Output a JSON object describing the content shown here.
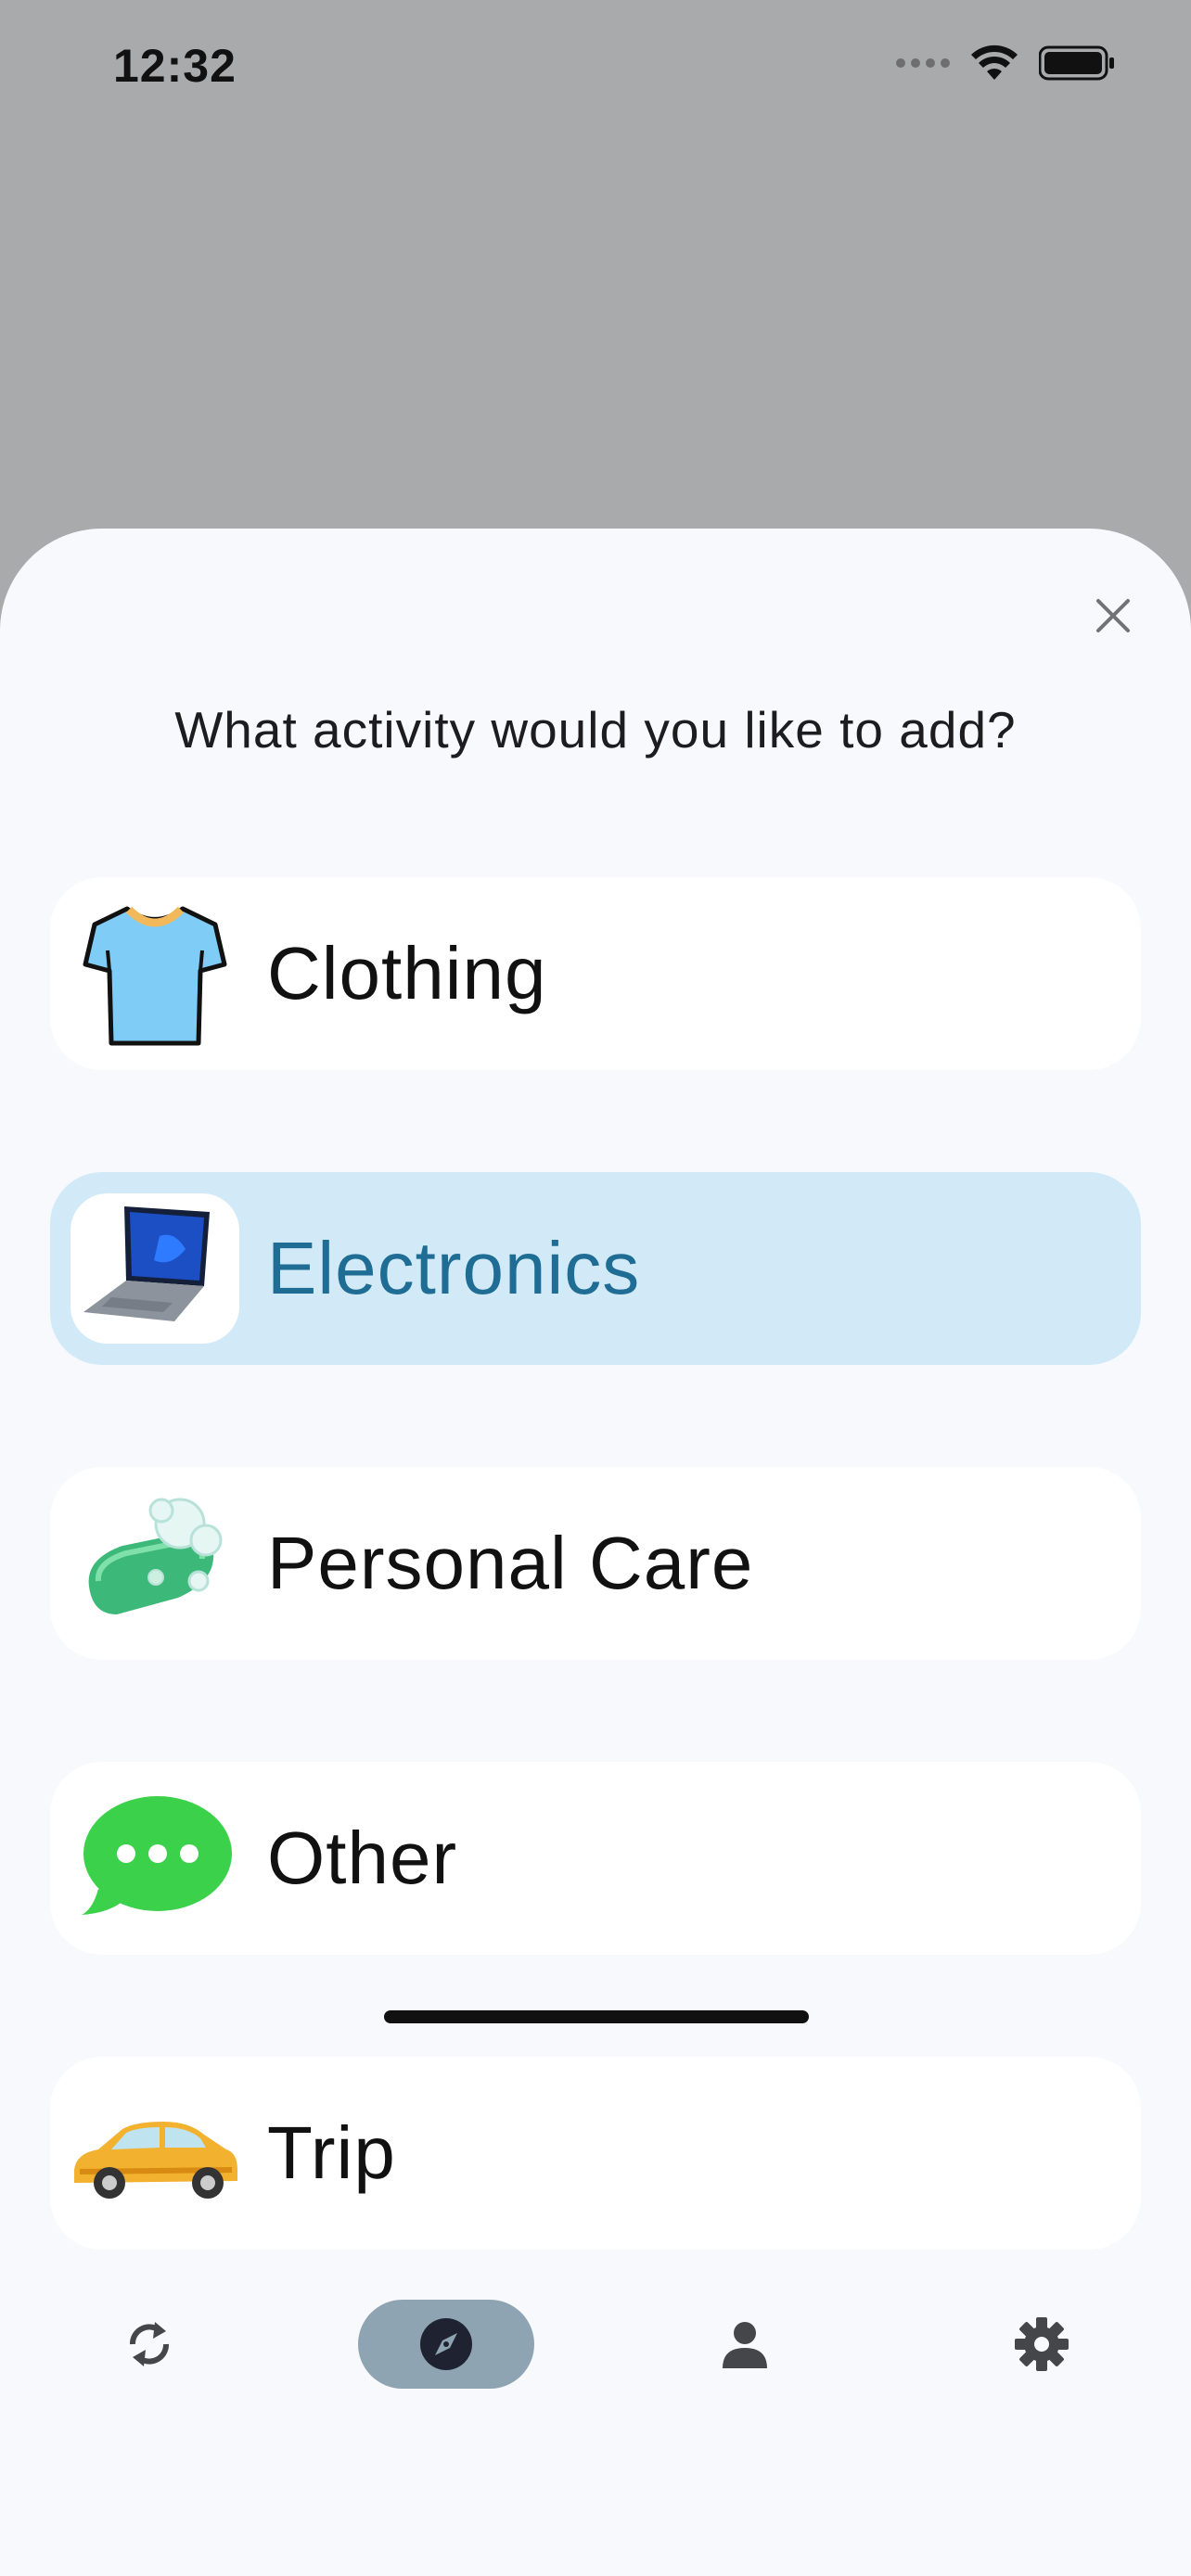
{
  "status_bar": {
    "time": "12:32"
  },
  "sheet": {
    "prompt": "What activity would you like to add?",
    "options": [
      {
        "label": "Clothing",
        "icon": "tshirt-icon",
        "selected": false
      },
      {
        "label": "Electronics",
        "icon": "laptop-icon",
        "selected": true
      },
      {
        "label": "Personal Care",
        "icon": "soap-icon",
        "selected": false
      },
      {
        "label": "Other",
        "icon": "chat-bubble-icon",
        "selected": false
      },
      {
        "label": "Trip",
        "icon": "car-icon",
        "selected": false
      }
    ]
  },
  "bottom_nav": {
    "items": [
      {
        "icon": "sync-icon",
        "active": false
      },
      {
        "icon": "compass-icon",
        "active": true
      },
      {
        "icon": "person-icon",
        "active": false
      },
      {
        "icon": "gear-icon",
        "active": false
      }
    ]
  },
  "colors": {
    "backdrop": "#a9aaac",
    "sheet": "#f7f9fc",
    "selected_bg": "#d2eaf8",
    "selected_text": "#1f6d94",
    "nav_active": "#8fa4b3"
  }
}
